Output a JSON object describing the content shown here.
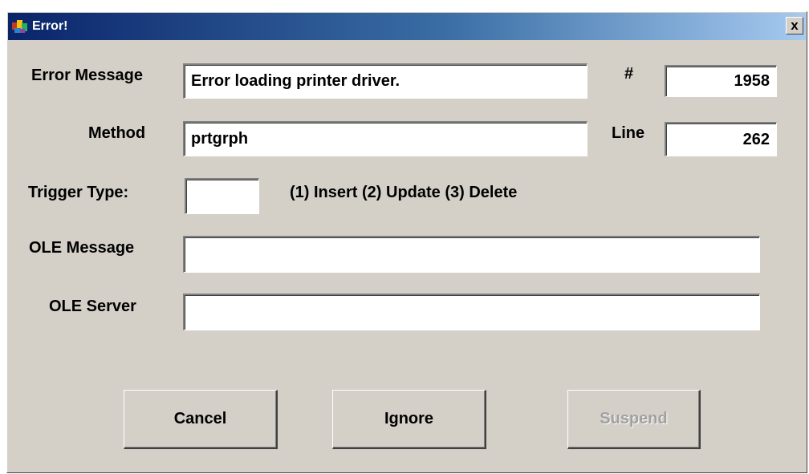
{
  "window": {
    "title": "Error!",
    "close_label": "x"
  },
  "form": {
    "error_message_label": "Error Message",
    "error_message_value": "Error loading printer driver.",
    "number_label": "#",
    "number_value": "1958",
    "method_label": "Method",
    "method_value": "prtgrph",
    "line_label": "Line",
    "line_value": "262",
    "trigger_type_label": "Trigger Type:",
    "trigger_type_value": "",
    "trigger_type_hint": "(1) Insert (2) Update (3) Delete",
    "ole_message_label": "OLE Message",
    "ole_message_value": "",
    "ole_server_label": "OLE Server",
    "ole_server_value": ""
  },
  "buttons": {
    "cancel_label": "Cancel",
    "ignore_label": "Ignore",
    "suspend_label": "Suspend",
    "suspend_enabled": false
  },
  "icons": {
    "app_icon": "app-icon",
    "close_icon": "close-icon"
  },
  "colors": {
    "title_gradient_start": "#0a246a",
    "title_gradient_end": "#a6caf0",
    "dialog_face": "#d4d0c8",
    "disabled_text": "#a0a0a0"
  }
}
